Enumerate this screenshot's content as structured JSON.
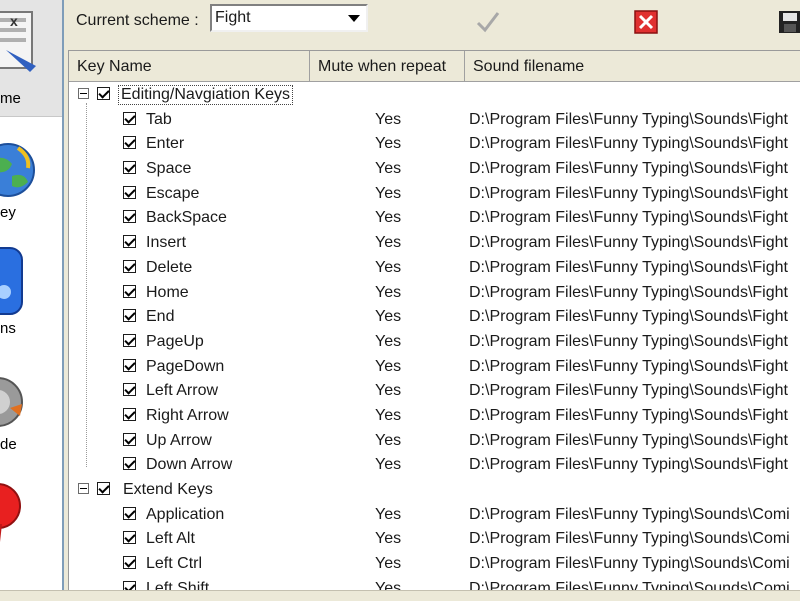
{
  "sidebar": {
    "items": [
      {
        "label": "me",
        "icon": "scheme-icon"
      },
      {
        "label": "ey",
        "icon": "globe-icon"
      },
      {
        "label": "ns",
        "icon": "options-icon"
      },
      {
        "label": "de",
        "icon": "mode-icon"
      },
      {
        "label": "",
        "icon": "red-ball-icon"
      }
    ]
  },
  "toolbar": {
    "scheme_label": "Current scheme :",
    "scheme_value": "Fight",
    "apply_icon": "checkmark-icon",
    "delete_icon": "red-x-icon",
    "save_icon": "floppy-disk-icon"
  },
  "grid": {
    "columns": [
      "Key Name",
      "Mute when repeat",
      "Sound filename"
    ],
    "groups": [
      {
        "name": "Editing/Navgiation Keys",
        "rows": [
          {
            "name": "Tab",
            "mute": "Yes",
            "file": "D:\\Program Files\\Funny Typing\\Sounds\\Fight"
          },
          {
            "name": "Enter",
            "mute": "Yes",
            "file": "D:\\Program Files\\Funny Typing\\Sounds\\Fight"
          },
          {
            "name": "Space",
            "mute": "Yes",
            "file": "D:\\Program Files\\Funny Typing\\Sounds\\Fight"
          },
          {
            "name": "Escape",
            "mute": "Yes",
            "file": "D:\\Program Files\\Funny Typing\\Sounds\\Fight"
          },
          {
            "name": "BackSpace",
            "mute": "Yes",
            "file": "D:\\Program Files\\Funny Typing\\Sounds\\Fight"
          },
          {
            "name": "Insert",
            "mute": "Yes",
            "file": "D:\\Program Files\\Funny Typing\\Sounds\\Fight"
          },
          {
            "name": "Delete",
            "mute": "Yes",
            "file": "D:\\Program Files\\Funny Typing\\Sounds\\Fight"
          },
          {
            "name": "Home",
            "mute": "Yes",
            "file": "D:\\Program Files\\Funny Typing\\Sounds\\Fight"
          },
          {
            "name": "End",
            "mute": "Yes",
            "file": "D:\\Program Files\\Funny Typing\\Sounds\\Fight"
          },
          {
            "name": "PageUp",
            "mute": "Yes",
            "file": "D:\\Program Files\\Funny Typing\\Sounds\\Fight"
          },
          {
            "name": "PageDown",
            "mute": "Yes",
            "file": "D:\\Program Files\\Funny Typing\\Sounds\\Fight"
          },
          {
            "name": "Left Arrow",
            "mute": "Yes",
            "file": "D:\\Program Files\\Funny Typing\\Sounds\\Fight"
          },
          {
            "name": "Right Arrow",
            "mute": "Yes",
            "file": "D:\\Program Files\\Funny Typing\\Sounds\\Fight"
          },
          {
            "name": "Up Arrow",
            "mute": "Yes",
            "file": "D:\\Program Files\\Funny Typing\\Sounds\\Fight"
          },
          {
            "name": "Down Arrow",
            "mute": "Yes",
            "file": "D:\\Program Files\\Funny Typing\\Sounds\\Fight"
          }
        ]
      },
      {
        "name": "Extend Keys",
        "rows": [
          {
            "name": "Application",
            "mute": "Yes",
            "file": "D:\\Program Files\\Funny Typing\\Sounds\\Comi"
          },
          {
            "name": "Left Alt",
            "mute": "Yes",
            "file": "D:\\Program Files\\Funny Typing\\Sounds\\Comi"
          },
          {
            "name": "Left Ctrl",
            "mute": "Yes",
            "file": "D:\\Program Files\\Funny Typing\\Sounds\\Comi"
          },
          {
            "name": "Left Shift",
            "mute": "Yes",
            "file": "D:\\Program Files\\Funny Typing\\Sounds\\Comi"
          }
        ]
      }
    ]
  },
  "colors": {
    "background": "#ece9d8",
    "grid_border": "#9a9a9a",
    "delete_red": "#e03030",
    "sidebar_border": "#7f9db9"
  }
}
